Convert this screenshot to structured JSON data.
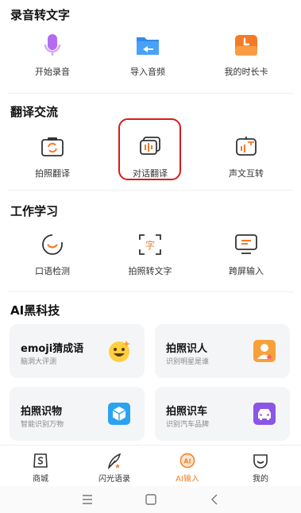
{
  "sections": {
    "recording": {
      "title": "录音转文字",
      "items": [
        {
          "label": "开始录音",
          "icon": "microphone-icon"
        },
        {
          "label": "导入音频",
          "icon": "import-folder-icon"
        },
        {
          "label": "我的时长卡",
          "icon": "duration-card-icon"
        }
      ]
    },
    "translate": {
      "title": "翻译交流",
      "items": [
        {
          "label": "拍照翻译",
          "icon": "photo-translate-icon"
        },
        {
          "label": "对话翻译",
          "icon": "dialogue-translate-icon"
        },
        {
          "label": "声文互转",
          "icon": "voice-text-convert-icon"
        }
      ]
    },
    "work": {
      "title": "工作学习",
      "items": [
        {
          "label": "口语检测",
          "icon": "speaking-check-icon"
        },
        {
          "label": "拍照转文字",
          "icon": "photo-to-text-icon"
        },
        {
          "label": "跨屏输入",
          "icon": "cross-screen-input-icon"
        }
      ]
    },
    "ai": {
      "title": "AI黑科技",
      "cards": [
        {
          "title": "emoji猜成语",
          "subtitle": "脑洞大评测",
          "icon": "emoji-face-icon"
        },
        {
          "title": "拍照识人",
          "subtitle": "识别明星是谁",
          "icon": "person-id-icon"
        },
        {
          "title": "拍照识物",
          "subtitle": "智能识别万物",
          "icon": "object-id-icon"
        },
        {
          "title": "拍照识车",
          "subtitle": "识别汽车品牌",
          "icon": "car-id-icon"
        }
      ]
    }
  },
  "bottom_nav": [
    {
      "label": "商城",
      "icon": "store-icon",
      "active": false
    },
    {
      "label": "闪光语录",
      "icon": "quote-feather-icon",
      "active": false
    },
    {
      "label": "AI输入",
      "icon": "ai-input-icon",
      "active": true
    },
    {
      "label": "我的",
      "icon": "profile-icon",
      "active": false
    }
  ],
  "system_nav": [
    "menu-icon",
    "home-square-icon",
    "back-chevron-icon"
  ],
  "colors": {
    "highlight": "#d71b1b",
    "active_nav": "#f0832c",
    "mic_purple": "#b36cf0",
    "folder_blue": "#2e8cf0",
    "orange": "#f57a28"
  }
}
